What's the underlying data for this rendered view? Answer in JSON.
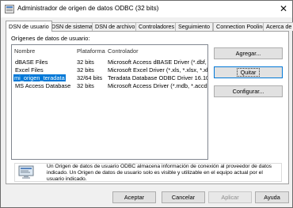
{
  "window": {
    "title": "Administrador de origen de datos ODBC (32 bits)"
  },
  "tabs": [
    {
      "label": "DSN de usuario"
    },
    {
      "label": "DSN de sistema"
    },
    {
      "label": "DSN de archivo"
    },
    {
      "label": "Controladores"
    },
    {
      "label": "Seguimiento"
    },
    {
      "label": "Connection Pooling"
    },
    {
      "label": "Acerca de"
    }
  ],
  "panel": {
    "section_label": "Orígenes de datos de usuario:",
    "columns": [
      "Nombre",
      "Plataforma",
      "Controlador"
    ],
    "rows": [
      [
        "dBASE Files",
        "32 bits",
        "Microsoft Access dBASE Driver (*.dbf, *.ndx, *.mdx)"
      ],
      [
        "Excel Files",
        "32 bits",
        "Microsoft Excel Driver (*.xls, *.xlsx, *.xlsm, *.xlsb)"
      ],
      [
        "mi_origen_teradata",
        "32/64 bits",
        "Teradata Database ODBC Driver 16.10"
      ],
      [
        "MS Access Database",
        "32 bits",
        "Microsoft Access Driver (*.mdb, *.accdb)"
      ]
    ],
    "buttons": {
      "add": "Agregar...",
      "remove": "Quitar",
      "configure": "Configurar..."
    },
    "info_text": "Un Origen de datos de usuario ODBC almacena información de conexión al proveedor de datos indicado. Un Origen de datos de usuario solo es visible y utilizable en el equipo actual por el usuario indicado."
  },
  "footer": {
    "ok": "Aceptar",
    "cancel": "Cancelar",
    "apply": "Aplicar",
    "help": "Ayuda"
  }
}
